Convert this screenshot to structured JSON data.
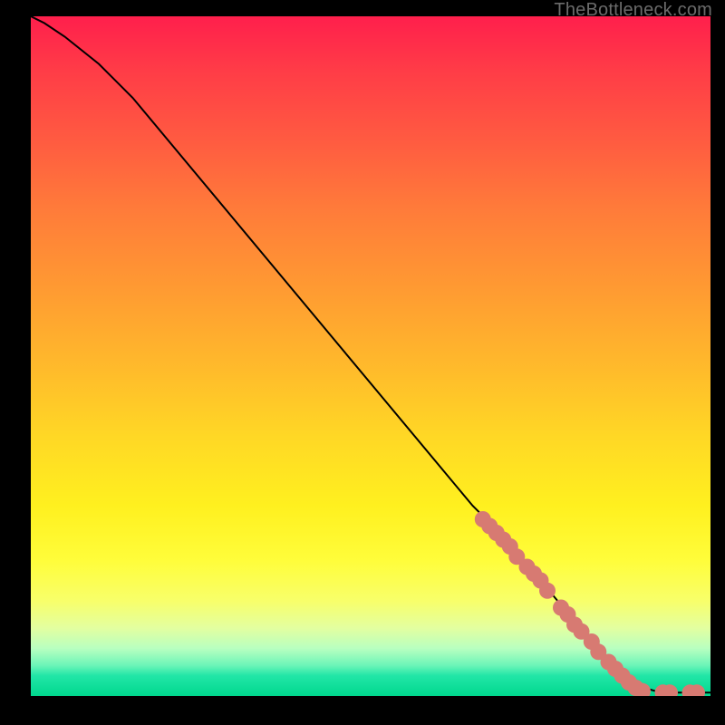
{
  "attribution": "TheBottleneck.com",
  "chart_data": {
    "type": "line",
    "title": "",
    "xlabel": "",
    "ylabel": "",
    "xlim": [
      0,
      100
    ],
    "ylim": [
      0,
      100
    ],
    "grid": false,
    "legend": false,
    "series": [
      {
        "name": "curve",
        "x": [
          0,
          2,
          5,
          10,
          15,
          20,
          25,
          30,
          35,
          40,
          45,
          50,
          55,
          60,
          65,
          70,
          75,
          80,
          83,
          85,
          88,
          90,
          92,
          95,
          100
        ],
        "y": [
          100,
          99,
          97,
          93,
          88,
          82,
          76,
          70,
          64,
          58,
          52,
          46,
          40,
          34,
          28,
          23,
          17,
          11,
          7,
          5,
          2.5,
          1.3,
          0.7,
          0.5,
          0.5
        ]
      }
    ],
    "scatter": [
      {
        "name": "dots",
        "color": "#d77a72",
        "points": [
          {
            "x": 66.5,
            "y": 26.0
          },
          {
            "x": 67.5,
            "y": 25.0
          },
          {
            "x": 68.5,
            "y": 24.0
          },
          {
            "x": 69.5,
            "y": 23.0
          },
          {
            "x": 70.5,
            "y": 22.0
          },
          {
            "x": 71.5,
            "y": 20.5
          },
          {
            "x": 73.0,
            "y": 19.0
          },
          {
            "x": 74.0,
            "y": 18.0
          },
          {
            "x": 75.0,
            "y": 17.0
          },
          {
            "x": 76.0,
            "y": 15.5
          },
          {
            "x": 78.0,
            "y": 13.0
          },
          {
            "x": 79.0,
            "y": 12.0
          },
          {
            "x": 80.0,
            "y": 10.5
          },
          {
            "x": 81.0,
            "y": 9.5
          },
          {
            "x": 82.5,
            "y": 8.0
          },
          {
            "x": 83.5,
            "y": 6.5
          },
          {
            "x": 85.0,
            "y": 5.0
          },
          {
            "x": 86.0,
            "y": 4.0
          },
          {
            "x": 87.0,
            "y": 3.0
          },
          {
            "x": 88.0,
            "y": 2.0
          },
          {
            "x": 89.0,
            "y": 1.2
          },
          {
            "x": 90.0,
            "y": 0.7
          },
          {
            "x": 93.0,
            "y": 0.5
          },
          {
            "x": 94.0,
            "y": 0.5
          },
          {
            "x": 97.0,
            "y": 0.5
          },
          {
            "x": 98.0,
            "y": 0.5
          }
        ]
      }
    ]
  }
}
